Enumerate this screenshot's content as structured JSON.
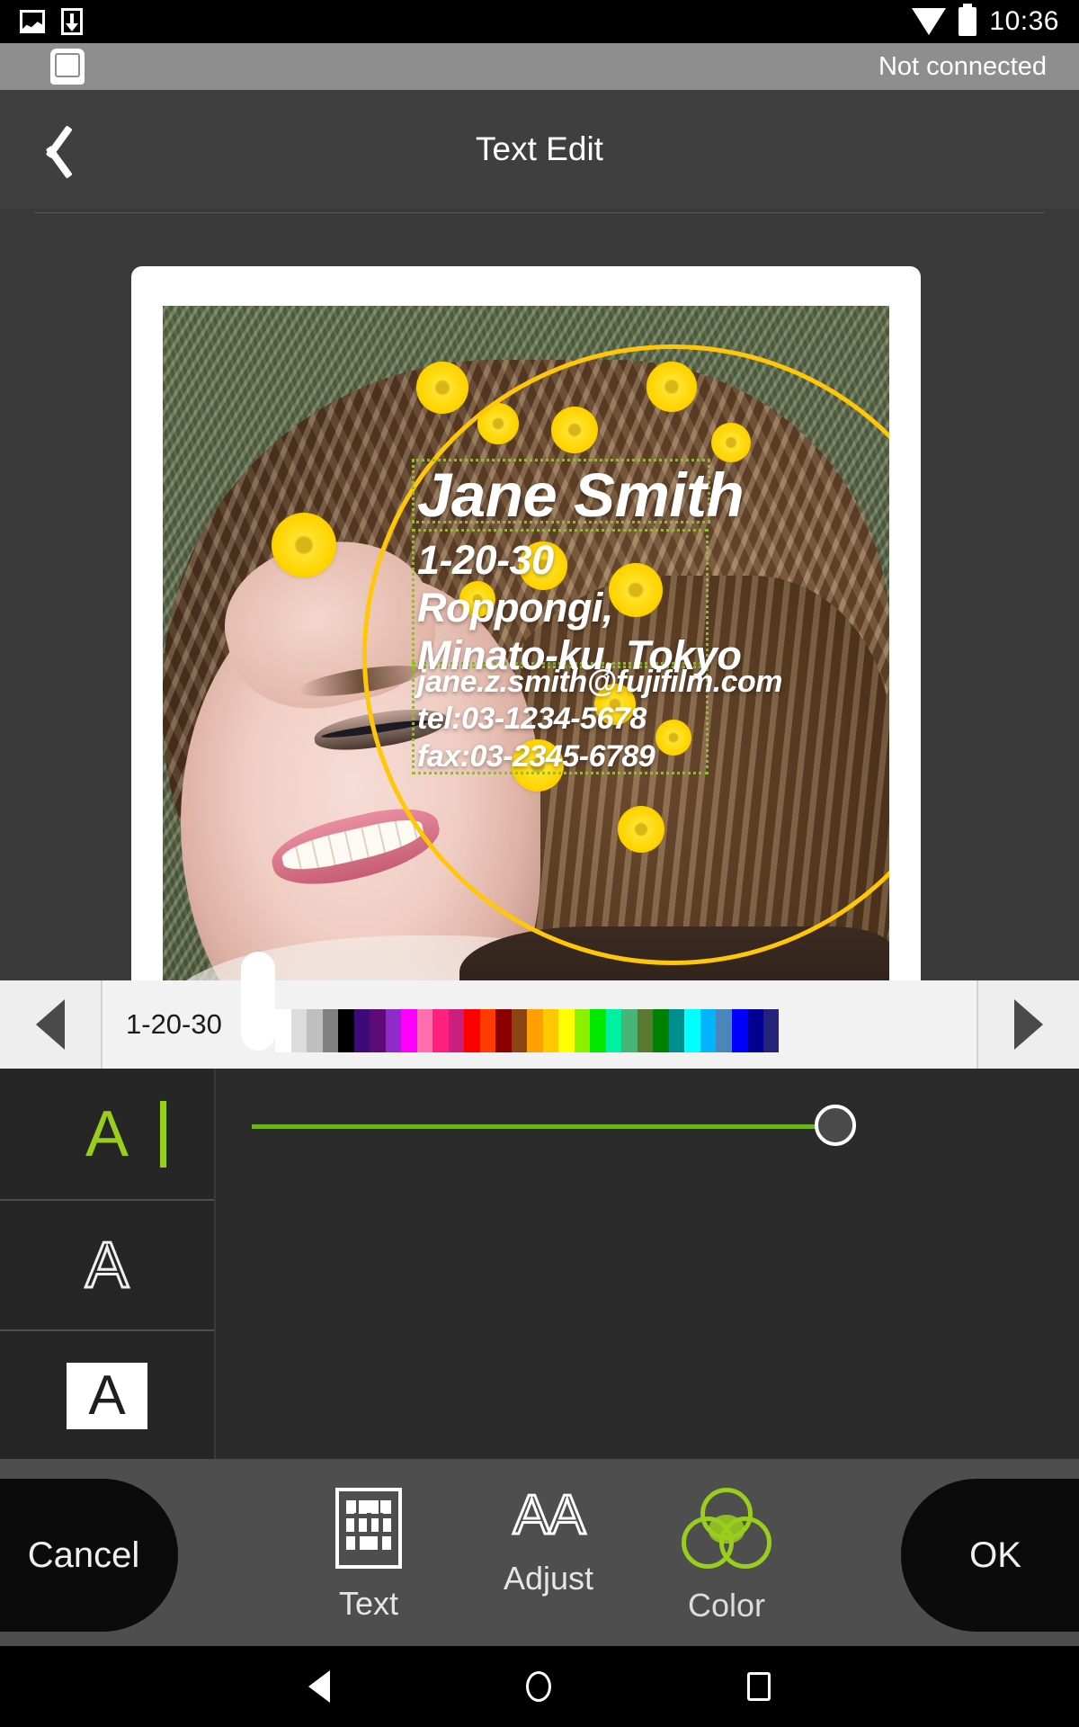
{
  "statusbar": {
    "time": "10:36",
    "icons": [
      "gallery-icon",
      "download-icon",
      "wifi-icon",
      "battery-icon"
    ]
  },
  "connection_bar": {
    "status": "Not connected",
    "printer_icon": "printer-icon"
  },
  "titlebar": {
    "title": "Text Edit",
    "back_icon": "back-chevron-icon"
  },
  "preview": {
    "overlay": {
      "name": "Jane Smith",
      "address": "1-20-30\nRoppongi,\nMinato-ku, Tokyo",
      "contact": "jane.z.smith@fujifilm.com\ntel:03-1234-5678\nfax:03-2345-6789"
    },
    "circle_color": "#ffc707",
    "selection_color": "#8bc220"
  },
  "text_nav": {
    "prev_label": "prev-text-arrow",
    "next_label": "next-text-arrow",
    "value": "1-20-30",
    "placeholder": "1-20-30"
  },
  "color_panel": {
    "styles": [
      {
        "name": "fill-style",
        "glyph": "A",
        "selected": true
      },
      {
        "name": "outline-style",
        "glyph": "A",
        "selected": false
      },
      {
        "name": "background-style",
        "glyph": "A",
        "selected": false
      }
    ],
    "accent": "#9ace1d",
    "selected_swatch": "#ffffff",
    "swatches": [
      "#ffffff",
      "#dcdcdc",
      "#bfbfbf",
      "#808080",
      "#000000",
      "#3d0a78",
      "#5f0a78",
      "#8f2bc9",
      "#ff00ff",
      "#ff6fb0",
      "#ff2080",
      "#c9207f",
      "#ff0000",
      "#ff3c00",
      "#8a0000",
      "#8a4513",
      "#ffa000",
      "#ffc800",
      "#ffff00",
      "#8cf000",
      "#00e800",
      "#00f0a0",
      "#48b478",
      "#5a7830",
      "#008000",
      "#008f8f",
      "#00ffff",
      "#00b4ff",
      "#4b86bb",
      "#0000ff",
      "#000091",
      "#23237a"
    ],
    "slider": {
      "name": "size-slider",
      "value": 100,
      "min": 0,
      "max": 100,
      "track_color": "#6db31c"
    }
  },
  "toolbar": {
    "cancel_label": "Cancel",
    "ok_label": "OK",
    "tools": [
      {
        "name": "tool-text",
        "label": "Text",
        "icon": "keyboard-icon",
        "active": false
      },
      {
        "name": "tool-adjust",
        "label": "Adjust",
        "icon": "aa-icon",
        "active": false
      },
      {
        "name": "tool-color",
        "label": "Color",
        "icon": "color-circles-icon",
        "active": true
      }
    ]
  },
  "android_nav": {
    "back": "back-nav-icon",
    "home": "home-nav-icon",
    "recents": "recents-nav-icon"
  }
}
